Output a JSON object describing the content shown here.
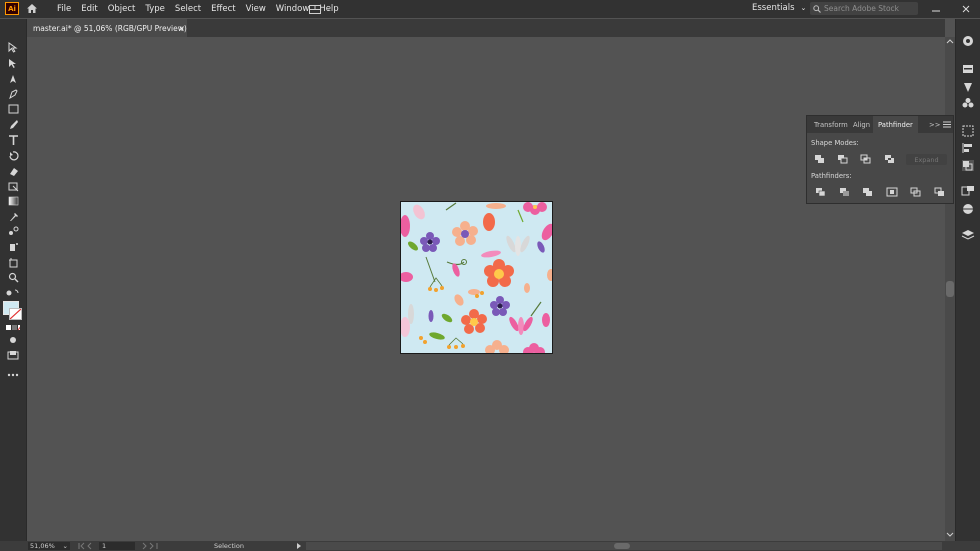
{
  "app": {
    "logo": "Ai"
  },
  "menubar": {
    "items": [
      "File",
      "Edit",
      "Object",
      "Type",
      "Select",
      "Effect",
      "View",
      "Window",
      "Help"
    ],
    "workspace": "Essentials",
    "search_placeholder": "Search Adobe Stock"
  },
  "document_tab": {
    "title": "master.ai* @ 51,06% (RGB/GPU Preview)",
    "close": "×"
  },
  "panel": {
    "tabs": [
      "Transform",
      "Align",
      "Pathfinder"
    ],
    "active_tab": "Pathfinder",
    "more": ">>",
    "shape_modes_label": "Shape Modes:",
    "pathfinders_label": "Pathfinders:",
    "expand_label": "Expand"
  },
  "statusbar": {
    "zoom": "51,06%",
    "page": "1",
    "status": "Selection"
  },
  "colors": {
    "accent": "#ff9a00",
    "artboard_bg": "#cfe9f2",
    "ui_dark": "#323232",
    "canvas": "#535353"
  }
}
